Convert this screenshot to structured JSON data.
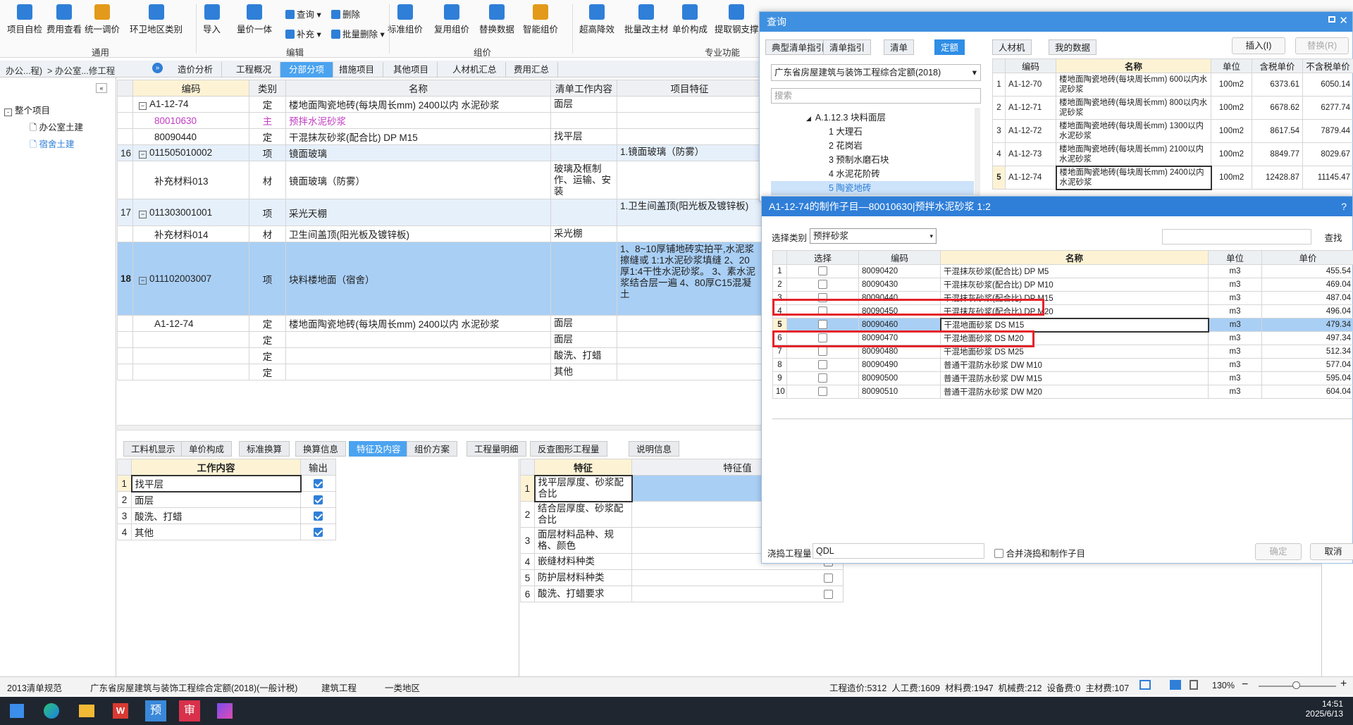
{
  "ribbon": {
    "big": [
      {
        "label": "项目自检",
        "icon": "check-icon",
        "color": "#2f7fd8"
      },
      {
        "label": "费用查看",
        "icon": "view-fee-icon",
        "color": "#2f7fd8"
      },
      {
        "label": "统一调价",
        "icon": "adjust-price-icon",
        "color": "#e39a1b"
      },
      {
        "label": "环卫地区类别",
        "icon": "region-icon",
        "color": "#2f7fd8"
      },
      {
        "label": "导入",
        "icon": "import-icon",
        "color": "#2f7fd8"
      },
      {
        "label": "量价一体",
        "icon": "qty-price-icon",
        "color": "#2f7fd8"
      },
      {
        "label": "标准组价",
        "icon": "std-price-icon",
        "color": "#2f7fd8"
      },
      {
        "label": "复用组价",
        "icon": "reuse-icon",
        "color": "#2f7fd8"
      },
      {
        "label": "替换数据",
        "icon": "replace-icon",
        "color": "#2f7fd8"
      },
      {
        "label": "智能组价",
        "icon": "smart-icon",
        "color": "#e39a1b"
      },
      {
        "label": "超高降效",
        "icon": "high-icon",
        "color": "#2f7fd8"
      },
      {
        "label": "批量改主材",
        "icon": "batch-main-icon",
        "color": "#2f7fd8"
      },
      {
        "label": "单价构成",
        "icon": "unit-price-icon",
        "color": "#2f7fd8"
      },
      {
        "label": "提取钢支撑",
        "icon": "steel-icon",
        "color": "#2f7fd8"
      }
    ],
    "small": [
      {
        "label": "查询"
      },
      {
        "label": "删除"
      },
      {
        "label": "补充"
      },
      {
        "label": "批量删除"
      }
    ],
    "groups": {
      "general": "通用",
      "edit": "编辑",
      "pricing": "组价",
      "special": "专业功能"
    }
  },
  "breadcrumb": {
    "text": "办公...程)",
    "sub": "办公室...修工程"
  },
  "tabs": [
    "造价分析",
    "工程概况",
    "分部分项",
    "措施项目",
    "其他项目",
    "人材机汇总",
    "费用汇总"
  ],
  "tree": {
    "root": "整个项目",
    "items": [
      "办公室土建",
      "宿舍土建"
    ]
  },
  "main": {
    "headers": [
      "编码",
      "类别",
      "名称",
      "清单工作内容",
      "项目特征"
    ],
    "rows": [
      {
        "no": "",
        "code": "A1-12-74",
        "type": "定",
        "name": "楼地面陶瓷地砖(每块周长mm) 2400以内 水泥砂浆",
        "work": "面层",
        "feat": "",
        "style": "norm",
        "fold": true
      },
      {
        "no": "",
        "code": "80010630",
        "type": "主",
        "name": "预拌水泥砂浆",
        "work": "",
        "feat": "",
        "style": "pink",
        "fold": false
      },
      {
        "no": "",
        "code": "80090440",
        "type": "定",
        "name": "干混抹灰砂浆(配合比) DP M15",
        "work": "找平层",
        "feat": "",
        "style": "norm",
        "fold": false
      },
      {
        "no": "16",
        "code": "011505010002",
        "type": "项",
        "name": "镜面玻璃",
        "work": "",
        "feat": "1.镜面玻璃（防雾）",
        "style": "proj",
        "fold": true
      },
      {
        "no": "",
        "code": "补充材料013",
        "type": "材",
        "name": "镜面玻璃（防雾）",
        "work": "玻璃及框制作、运输、安装",
        "feat": "",
        "style": "norm",
        "fold": false,
        "tall": true
      },
      {
        "no": "17",
        "code": "011303001001",
        "type": "项",
        "name": "采光天棚",
        "work": "",
        "feat": "1.卫生间盖顶(阳光板及镀锌板)",
        "style": "proj",
        "fold": true
      },
      {
        "no": "",
        "code": "补充材料014",
        "type": "材",
        "name": "卫生间盖顶(阳光板及镀锌板)",
        "work": "采光棚",
        "feat": "",
        "style": "norm",
        "fold": false
      },
      {
        "no": "18",
        "code": "011102003007",
        "type": "项",
        "name": "块料楼地面（宿舍）",
        "work": "",
        "feat": "1、8~10厚铺地砖实拍平,水泥浆擦缝或 1:1水泥砂浆填缝 2、20厚1:4干性水泥砂浆。 3、素水泥浆结合层一遍 4、80厚C15混凝土",
        "style": "sel",
        "fold": true
      },
      {
        "no": "",
        "code": "A1-12-74",
        "type": "定",
        "name": "楼地面陶瓷地砖(每块周长mm) 2400以内 水泥砂浆",
        "work": "面层",
        "feat": "",
        "style": "norm",
        "fold": false
      },
      {
        "no": "",
        "code": "",
        "type": "定",
        "name": "",
        "work": "面层",
        "feat": "",
        "style": "norm",
        "fold": false
      },
      {
        "no": "",
        "code": "",
        "type": "定",
        "name": "",
        "work": "酸洗、打蜡",
        "feat": "",
        "style": "norm",
        "fold": false
      },
      {
        "no": "",
        "code": "",
        "type": "定",
        "name": "",
        "work": "其他",
        "feat": "",
        "style": "norm",
        "fold": false
      }
    ]
  },
  "bottom_tabs": [
    "工料机显示",
    "单价构成",
    "标准换算",
    "换算信息",
    "特征及内容",
    "组价方案",
    "工程量明细",
    "反查图形工程量",
    "说明信息"
  ],
  "work_table": {
    "headers": [
      "工作内容",
      "输出"
    ],
    "rows": [
      {
        "no": "1",
        "name": "找平层",
        "out": true
      },
      {
        "no": "2",
        "name": "面层",
        "out": true
      },
      {
        "no": "3",
        "name": "酸洗、打蜡",
        "out": true
      },
      {
        "no": "4",
        "name": "其他",
        "out": true
      }
    ]
  },
  "feat_table": {
    "headers": [
      "特征",
      "特征值"
    ],
    "rows": [
      {
        "no": "1",
        "name": "找平层厚度、砂浆配合比"
      },
      {
        "no": "2",
        "name": "结合层厚度、砂浆配合比"
      },
      {
        "no": "3",
        "name": "面层材料品种、规格、颜色"
      },
      {
        "no": "4",
        "name": "嵌缝材料种类"
      },
      {
        "no": "5",
        "name": "防护层材料种类"
      },
      {
        "no": "6",
        "name": "酸洗、打蜡要求"
      }
    ]
  },
  "query": {
    "title": "查询",
    "tabs": [
      "典型清单指引",
      "清单指引",
      "清单",
      "定额",
      "人材机",
      "我的数据"
    ],
    "insert": "插入(I)",
    "replace": "替换(R)",
    "quota_select": "广东省房屋建筑与装饰工程综合定额(2018)",
    "search_placeholder": "搜索",
    "tree": [
      "A.1.12.3 块料面层",
      "1 大理石",
      "2 花岗岩",
      "3 预制水磨石块",
      "4 水泥花阶砖",
      "5 陶瓷地砖"
    ],
    "headers": [
      "编码",
      "名称",
      "单位",
      "含税单价",
      "不含税单价"
    ],
    "rows": [
      {
        "no": "1",
        "code": "A1-12-70",
        "name": "楼地面陶瓷地砖(每块周长mm) 600以内水泥砂浆",
        "unit": "100m2",
        "tax": "6373.61",
        "notax": "6050.14"
      },
      {
        "no": "2",
        "code": "A1-12-71",
        "name": "楼地面陶瓷地砖(每块周长mm) 800以内水泥砂浆",
        "unit": "100m2",
        "tax": "6678.62",
        "notax": "6277.74"
      },
      {
        "no": "3",
        "code": "A1-12-72",
        "name": "楼地面陶瓷地砖(每块周长mm) 1300以内水泥砂浆",
        "unit": "100m2",
        "tax": "8617.54",
        "notax": "7879.44"
      },
      {
        "no": "4",
        "code": "A1-12-73",
        "name": "楼地面陶瓷地砖(每块周长mm) 2100以内水泥砂浆",
        "unit": "100m2",
        "tax": "8849.77",
        "notax": "8029.67"
      },
      {
        "no": "5",
        "code": "A1-12-74",
        "name": "楼地面陶瓷地砖(每块周长mm) 2400以内水泥砂浆",
        "unit": "100m2",
        "tax": "12428.87",
        "notax": "11145.47"
      }
    ]
  },
  "sub": {
    "title": "A1-12-74的制作子目—80010630|预拌水泥砂浆 1:2",
    "help": "?",
    "category_label": "选择类别",
    "category_value": "预拌砂浆",
    "search_btn": "查找",
    "headers": [
      "选择",
      "编码",
      "名称",
      "单位",
      "单价"
    ],
    "rows": [
      {
        "no": "1",
        "code": "80090420",
        "name": "干混抹灰砂浆(配合比) DP M5",
        "unit": "m3",
        "price": "455.54"
      },
      {
        "no": "2",
        "code": "80090430",
        "name": "干混抹灰砂浆(配合比) DP M10",
        "unit": "m3",
        "price": "469.04"
      },
      {
        "no": "3",
        "code": "80090440",
        "name": "干混抹灰砂浆(配合比) DP M15",
        "unit": "m3",
        "price": "487.04"
      },
      {
        "no": "4",
        "code": "80090450",
        "name": "干混抹灰砂浆(配合比) DP M20",
        "unit": "m3",
        "price": "496.04"
      },
      {
        "no": "5",
        "code": "80090460",
        "name": "干混地面砂浆 DS M15",
        "unit": "m3",
        "price": "479.34"
      },
      {
        "no": "6",
        "code": "80090470",
        "name": "干混地面砂浆 DS M20",
        "unit": "m3",
        "price": "497.34"
      },
      {
        "no": "7",
        "code": "80090480",
        "name": "干混地面砂浆 DS M25",
        "unit": "m3",
        "price": "512.34"
      },
      {
        "no": "8",
        "code": "80090490",
        "name": "普通干混防水砂浆 DW M10",
        "unit": "m3",
        "price": "577.04"
      },
      {
        "no": "9",
        "code": "80090500",
        "name": "普通干混防水砂浆 DW M15",
        "unit": "m3",
        "price": "595.04"
      },
      {
        "no": "10",
        "code": "80090510",
        "name": "普通干混防水砂浆 DW M20",
        "unit": "m3",
        "price": "604.04"
      }
    ],
    "qty_label": "浇捣工程量",
    "qty_value": "QDL",
    "merge_label": "合并浇捣和制作子目",
    "ok": "确定",
    "cancel": "取消"
  },
  "status": {
    "items": [
      "2013清单规范",
      "广东省房屋建筑与装饰工程综合定额(2018)(一般计税)",
      "建筑工程",
      "一类地区"
    ],
    "right": "工程造价:5312  人工费:1609  材料费:1947  机械费:212  设备费:0  主材费:107",
    "zoom": "130%"
  },
  "taskbar": {
    "time": "14:51",
    "date": "2025/6/13"
  }
}
